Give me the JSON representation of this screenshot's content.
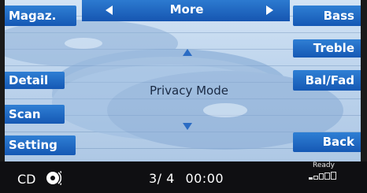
{
  "header": {
    "title": "More",
    "prev_icon": "triangle-left",
    "next_icon": "triangle-right"
  },
  "left_buttons": {
    "magazine": "Magaz.",
    "detail": "Detail",
    "scan": "Scan",
    "setting": "Setting"
  },
  "right_buttons": {
    "bass": "Bass",
    "treble": "Treble",
    "balance": "Bal/Fad",
    "back": "Back"
  },
  "center": {
    "mode": "Privacy Mode",
    "up_icon": "triangle-up",
    "down_icon": "triangle-down"
  },
  "status": {
    "source": "CD",
    "disc_icon": "cd-disc",
    "track": "3/ 4",
    "time": "00:00",
    "ready": "Ready",
    "magazine_slots_icon": "magazine-slots"
  },
  "colors": {
    "button_blue": "#1a65c0",
    "background": "#bcd3ec",
    "status_bar": "#0f0f12"
  }
}
